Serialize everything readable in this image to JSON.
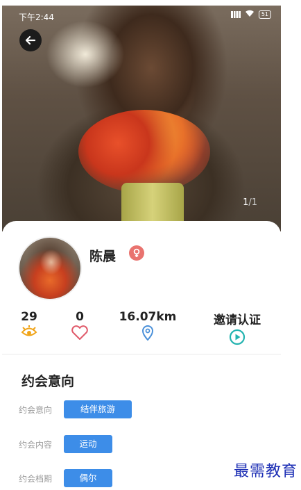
{
  "status_bar": {
    "time": "下午2:44",
    "battery": "51"
  },
  "photo": {
    "current": "1",
    "total": "/1"
  },
  "profile": {
    "name": "陈晨"
  },
  "stats": [
    {
      "value": "29",
      "icon": "eye-icon",
      "color": "#f0a419"
    },
    {
      "value": "0",
      "icon": "heart-icon",
      "color": "#e05a6a"
    },
    {
      "value": "16.07km",
      "icon": "location-pin-icon",
      "color": "#4a90d9"
    },
    {
      "value": "邀请认证",
      "icon": "play-circle-icon",
      "color": "#23b3b0"
    }
  ],
  "section": {
    "title": "约会意向",
    "rows": [
      {
        "label": "约会意向",
        "value": "结伴旅游"
      },
      {
        "label": "约会内容",
        "value": "运动"
      },
      {
        "label": "约会档期",
        "value": "偶尔"
      }
    ]
  },
  "watermark": "最需教育"
}
